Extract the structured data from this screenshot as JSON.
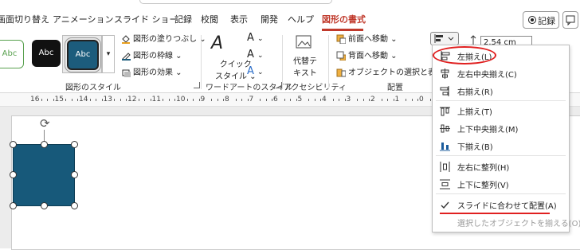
{
  "tabs": [
    {
      "label": "画面切り替え",
      "active": false
    },
    {
      "label": "アニメーション",
      "active": false
    },
    {
      "label": "スライド ショー",
      "active": false
    },
    {
      "label": "記録",
      "active": false
    },
    {
      "label": "校閲",
      "active": false
    },
    {
      "label": "表示",
      "active": false
    },
    {
      "label": "開発",
      "active": false
    },
    {
      "label": "ヘルプ",
      "active": false
    },
    {
      "label": "図形の書式",
      "active": true
    }
  ],
  "record_button": {
    "label": "記録"
  },
  "shape_styles": {
    "swatches": [
      "Abc",
      "Abc",
      "Abc"
    ],
    "fill": "図形の塗りつぶし",
    "outline": "図形の枠線",
    "effects": "図形の効果",
    "group_label": "図形のスタイル"
  },
  "wordart": {
    "quick_style_line1": "クイック",
    "quick_style_line2": "スタイル",
    "group_label": "ワードアートのスタイル"
  },
  "accessibility": {
    "alt_text_line1": "代替テ",
    "alt_text_line2": "キスト",
    "group_label": "アクセシビリティ"
  },
  "arrange": {
    "bring_forward": "前面へ移動",
    "send_backward": "背面へ移動",
    "selection_pane": "オブジェクトの選択と表示",
    "group_label": "配置"
  },
  "size": {
    "height": "2.54 cm"
  },
  "ruler": {
    "ticks": [
      "16",
      "15",
      "14",
      "13",
      "12",
      "11",
      "10",
      "9",
      "8",
      "7",
      "6",
      "5",
      "4",
      "3",
      "2",
      "1",
      "0",
      "1"
    ]
  },
  "align_menu": {
    "items": [
      {
        "label": "左揃え(L)",
        "icon": "align-left-icon",
        "highlighted": true
      },
      {
        "label": "左右中央揃え(C)",
        "icon": "align-center-icon"
      },
      {
        "label": "右揃え(R)",
        "icon": "align-right-icon"
      },
      {
        "label": "上揃え(T)",
        "icon": "align-top-icon"
      },
      {
        "label": "上下中央揃え(M)",
        "icon": "align-middle-icon"
      },
      {
        "label": "下揃え(B)",
        "icon": "align-bottom-icon"
      },
      {
        "label": "左右に整列(H)",
        "icon": "distribute-horizontal-icon"
      },
      {
        "label": "上下に整列(V)",
        "icon": "distribute-vertical-icon"
      },
      {
        "label": "スライドに合わせて配置(A)",
        "icon": "checkmark-icon",
        "checked": true
      },
      {
        "label": "選択したオブジェクトを揃える(O)",
        "icon": "",
        "disabled": true
      }
    ]
  },
  "colors": {
    "accent": "#c0392b",
    "shape_fill": "#17597a",
    "annotation": "#e02020"
  }
}
